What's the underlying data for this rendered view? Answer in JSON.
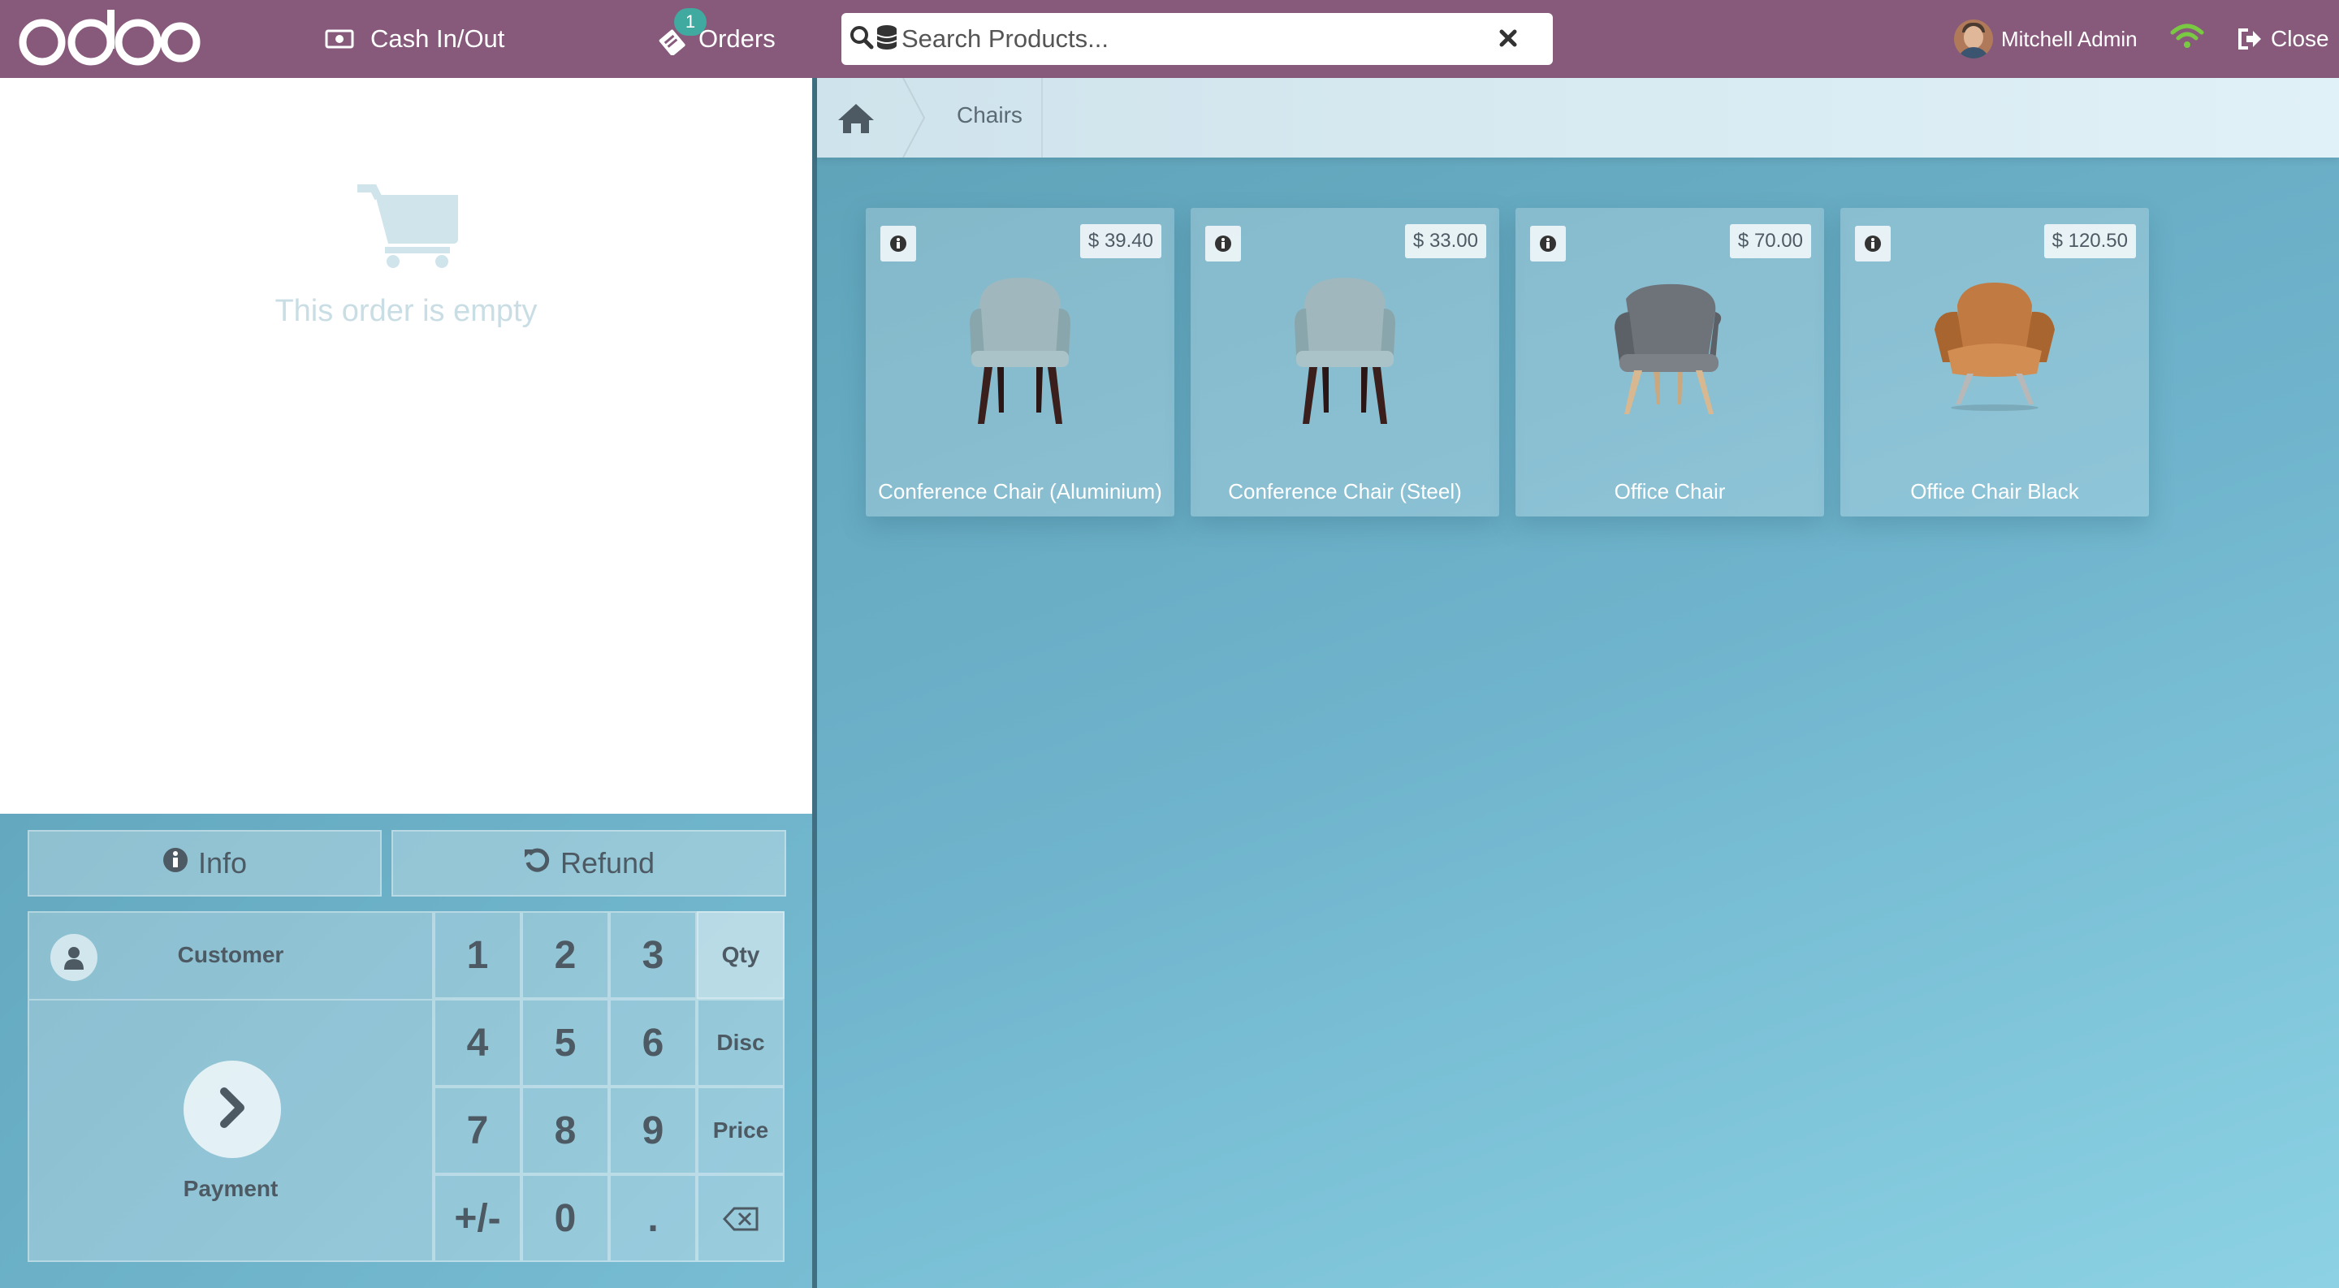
{
  "header": {
    "brand": "odoo",
    "cash_label": "Cash In/Out",
    "orders_label": "Orders",
    "orders_badge": "1",
    "search_placeholder": "Search Products...",
    "user_name": "Mitchell Admin",
    "close_label": "Close"
  },
  "order": {
    "empty_text": "This order is empty"
  },
  "control_buttons": {
    "info": "Info",
    "refund": "Refund"
  },
  "action_pad": {
    "customer": "Customer",
    "payment": "Payment"
  },
  "numpad": {
    "k1": "1",
    "k2": "2",
    "k3": "3",
    "k4": "4",
    "k5": "5",
    "k6": "6",
    "k7": "7",
    "k8": "8",
    "k9": "9",
    "sign": "+/-",
    "k0": "0",
    "dot": ".",
    "qty": "Qty",
    "disc": "Disc",
    "price": "Price",
    "active_mode": "Qty"
  },
  "breadcrumb": {
    "category": "Chairs"
  },
  "products": [
    {
      "name": "Conference Chair (Aluminium)",
      "price": "$ 39.40",
      "image": "conference-chair-aluminium"
    },
    {
      "name": "Conference Chair (Steel)",
      "price": "$ 33.00",
      "image": "conference-chair-steel"
    },
    {
      "name": "Office Chair",
      "price": "$ 70.00",
      "image": "office-chair-gray"
    },
    {
      "name": "Office Chair Black",
      "price": "$ 120.50",
      "image": "office-chair-tan"
    }
  ],
  "colors": {
    "brand": "#875a7b",
    "badge": "#40a9a0",
    "wifi_ok": "#7ac943"
  },
  "icons": [
    "money-icon",
    "orders-icon",
    "search-icon",
    "barcode-icon",
    "clear-icon",
    "wifi-icon",
    "sign-out-icon",
    "cart-icon",
    "info-icon",
    "undo-icon",
    "user-icon",
    "chevron-right-icon",
    "backspace-icon",
    "home-icon"
  ]
}
